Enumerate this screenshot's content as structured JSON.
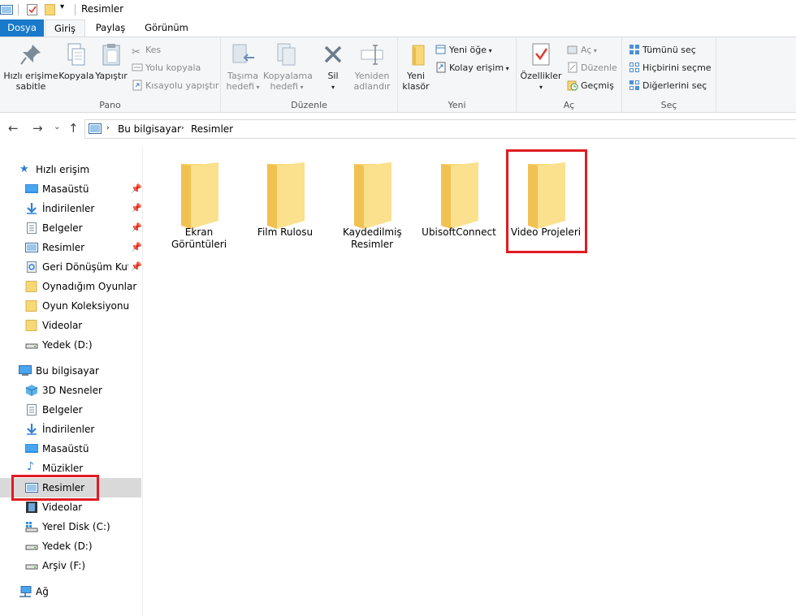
{
  "window": {
    "title": "Resimler"
  },
  "tabs": [
    {
      "label": "Dosya"
    },
    {
      "label": "Giriş"
    },
    {
      "label": "Paylaş"
    },
    {
      "label": "Görünüm"
    }
  ],
  "ribbon": {
    "pano": {
      "label": "Pano",
      "pin": "Hızlı erişime sabitle",
      "copy": "Kopyala",
      "paste": "Yapıştır",
      "cut": "Kes",
      "copy_path": "Yolu kopyala",
      "paste_shortcut": "Kısayolu yapıştır"
    },
    "duzenle": {
      "label": "Düzenle",
      "move_to": "Taşıma hedefi",
      "copy_to": "Kopyalama hedefi",
      "delete": "Sil",
      "rename": "Yeniden adlandır"
    },
    "yeni": {
      "label": "Yeni",
      "new_folder": "Yeni klasör",
      "new_item": "Yeni öğe",
      "easy_access": "Kolay erişim"
    },
    "ac": {
      "label": "Aç",
      "properties": "Özellikler",
      "open": "Aç",
      "edit": "Düzenle",
      "history": "Geçmiş"
    },
    "sec": {
      "label": "Seç",
      "select_all": "Tümünü seç",
      "select_none": "Hiçbirini seçme",
      "invert": "Diğerlerini seç"
    }
  },
  "breadcrumb": [
    "Bu bilgisayar",
    "Resimler"
  ],
  "nav": {
    "quick_access": "Hızlı erişim",
    "quick_items": [
      {
        "label": "Masaüstü",
        "icon": "desktop-icon"
      },
      {
        "label": "İndirilenler",
        "icon": "download-icon"
      },
      {
        "label": "Belgeler",
        "icon": "documents-icon"
      },
      {
        "label": "Resimler",
        "icon": "pictures-icon"
      },
      {
        "label": "Geri Dönüşüm Kutusu",
        "icon": "recycle-bin-icon"
      },
      {
        "label": "Oynadığım Oyunlar",
        "icon": "folder-icon"
      },
      {
        "label": "Oyun Koleksiyonu",
        "icon": "folder-icon"
      },
      {
        "label": "Videolar",
        "icon": "folder-icon"
      },
      {
        "label": "Yedek (D:)",
        "icon": "drive-icon"
      }
    ],
    "this_pc": "Bu bilgisayar",
    "pc_items": [
      {
        "label": "3D Nesneler",
        "icon": "3d-objects-icon"
      },
      {
        "label": "Belgeler",
        "icon": "documents-icon"
      },
      {
        "label": "İndirilenler",
        "icon": "download-icon"
      },
      {
        "label": "Masaüstü",
        "icon": "desktop-icon"
      },
      {
        "label": "Müzikler",
        "icon": "music-icon"
      },
      {
        "label": "Resimler",
        "icon": "pictures-icon"
      },
      {
        "label": "Videolar",
        "icon": "videos-icon"
      },
      {
        "label": "Yerel Disk (C:)",
        "icon": "system-drive-icon"
      },
      {
        "label": "Yedek (D:)",
        "icon": "drive-icon"
      },
      {
        "label": "Arşiv (F:)",
        "icon": "drive-icon"
      }
    ],
    "network": "Ağ"
  },
  "folders": [
    {
      "label": "Ekran Görüntüleri"
    },
    {
      "label": "Film Rulosu"
    },
    {
      "label": "Kaydedilmiş Resimler"
    },
    {
      "label": "UbisoftConnect"
    },
    {
      "label": "Video Projeleri"
    }
  ],
  "colors": {
    "accent": "#1979ca",
    "highlight_box": "#e01b22",
    "folder": "#f8d775",
    "selected": "#d9d9d9"
  }
}
